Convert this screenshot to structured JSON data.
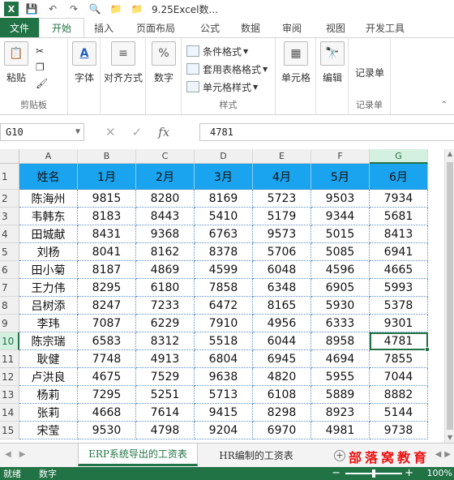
{
  "window": {
    "title": "9.25Excel数..."
  },
  "quick_access": {
    "logo_letter": "X"
  },
  "ribbon_tabs": [
    "文件",
    "开始",
    "插入",
    "页面布局",
    "公式",
    "数据",
    "审阅",
    "视图",
    "开发工具"
  ],
  "active_tab": "开始",
  "ribbon": {
    "clipboard": {
      "paste_label": "粘贴",
      "group_label": "剪贴板"
    },
    "font_label": "字体",
    "align_label": "对齐方式",
    "number_label": "数字",
    "styles": {
      "conditional": "条件格式",
      "table": "套用表格格式",
      "cell_styles": "单元格样式",
      "group_label": "样式"
    },
    "cells_label": "单元格",
    "edit_label": "编辑",
    "record": {
      "button_label": "记录单",
      "group_label": "记录单"
    }
  },
  "formula_bar": {
    "name_box": "G10",
    "value": "4781",
    "fx": "fx"
  },
  "grid": {
    "columns": [
      "A",
      "B",
      "C",
      "D",
      "E",
      "F",
      "G"
    ],
    "selected_column": "G",
    "selected_row": 10,
    "header": [
      "姓名",
      "1月",
      "2月",
      "3月",
      "4月",
      "5月",
      "6月"
    ],
    "rows": [
      [
        "陈海州",
        "9815",
        "8280",
        "8169",
        "5723",
        "9503",
        "7934"
      ],
      [
        "韦韩东",
        "8183",
        "8443",
        "5410",
        "5179",
        "9344",
        "5681"
      ],
      [
        "田城献",
        "8431",
        "9368",
        "6763",
        "9573",
        "5015",
        "8413"
      ],
      [
        "刘杨",
        "8041",
        "8162",
        "8378",
        "5706",
        "5085",
        "6941"
      ],
      [
        "田小菊",
        "8187",
        "4869",
        "4599",
        "6048",
        "4596",
        "4665"
      ],
      [
        "王力伟",
        "8295",
        "6180",
        "7858",
        "6348",
        "6905",
        "5993"
      ],
      [
        "吕树添",
        "8247",
        "7233",
        "6472",
        "8165",
        "5930",
        "5378"
      ],
      [
        "李玮",
        "7087",
        "6229",
        "7910",
        "4956",
        "6333",
        "9301"
      ],
      [
        "陈宗瑞",
        "6583",
        "8312",
        "5518",
        "6044",
        "8958",
        "4781"
      ],
      [
        "耿健",
        "7748",
        "4913",
        "6804",
        "6945",
        "4694",
        "7855"
      ],
      [
        "卢洪良",
        "4675",
        "7529",
        "9638",
        "4820",
        "5955",
        "7044"
      ],
      [
        "杨莉",
        "7295",
        "5251",
        "5713",
        "6108",
        "5889",
        "8882"
      ],
      [
        "张莉",
        "4668",
        "7614",
        "9415",
        "8298",
        "8923",
        "5144"
      ],
      [
        "宋莹",
        "9530",
        "4798",
        "9204",
        "6970",
        "4981",
        "9738"
      ]
    ],
    "row_numbers": [
      "1",
      "2",
      "3",
      "4",
      "5",
      "6",
      "7",
      "8",
      "9",
      "10",
      "11",
      "12",
      "13",
      "14",
      "15"
    ]
  },
  "sheets": [
    {
      "name": "ERP系统导出的工资表",
      "active": true
    },
    {
      "name": "HR编制的工资表",
      "active": false
    }
  ],
  "watermark": "部落窝教育",
  "status": {
    "ready": "就绪",
    "mode": "数字",
    "zoom": "100%"
  },
  "colors": {
    "excel_green": "#217346",
    "header_fill": "#1aa3ee"
  }
}
